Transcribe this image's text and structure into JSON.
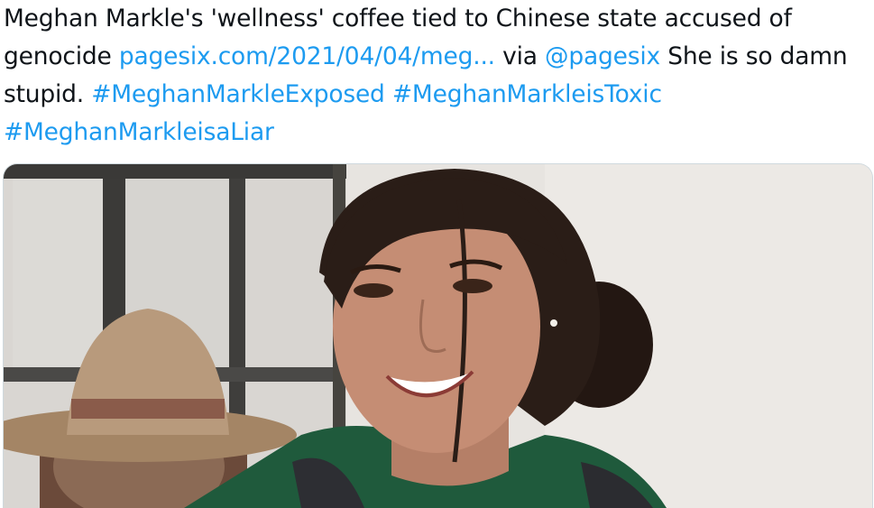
{
  "tweet": {
    "text_part1": "Meghan Markle's 'wellness' coffee tied to Chinese state accused of genocide ",
    "link": "pagesix.com/2021/04/04/meg...",
    "text_via": " via ",
    "mention": "@pagesix",
    "text_part2": " She is so damn stupid. ",
    "hashtags": [
      "#MeghanMarkleExposed",
      "#MeghanMarkleisToxic",
      "#MeghanMarkleisaLiar"
    ]
  },
  "media": {
    "description_icon": "photo-image",
    "colors": {
      "background": "#e7e4e0",
      "hair": "#2a1d17",
      "skin": "#c58d74",
      "coat": "#1f5a3c",
      "hat": "#b89a7c",
      "window_frame": "#3b3a38"
    }
  }
}
